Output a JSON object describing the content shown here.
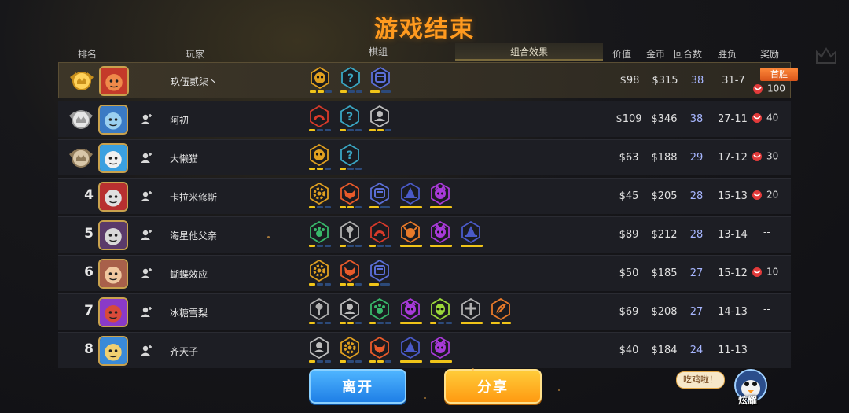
{
  "title": "游戏结束",
  "headers": {
    "rank": "排名",
    "player": "玩家",
    "tab_pieces": "棋组",
    "tab_synergy": "组合效果",
    "value": "价值",
    "gold": "金币",
    "rounds": "回合数",
    "wl": "胜负",
    "reward": "奖励"
  },
  "colors": {
    "accent": "#ff9a1f",
    "bar_on": "#f0c419",
    "bar_off": "#2c4a7a",
    "rounds": "#a7b6ff"
  },
  "players": [
    {
      "rank": "1",
      "medal": "gold-medal-icon",
      "name": "玖伍贰柒丶",
      "avatar": "red-ogre",
      "friend": false,
      "synergies": [
        {
          "icon": "head-icon",
          "ring": "#e0a020",
          "fill": "#e0a020",
          "bars": [
            1,
            1,
            0
          ]
        },
        {
          "icon": "question-icon",
          "ring": "#3aa7c4",
          "fill": "#3aa7c4",
          "bars": [
            1,
            0,
            0
          ]
        },
        {
          "icon": "mech-icon",
          "ring": "#5b6fd8",
          "fill": "#5b6fd8",
          "bars": [
            1,
            0
          ]
        }
      ],
      "value": "$98",
      "gold": "$315",
      "rounds": "38",
      "wl": "31-7",
      "badge": "首胜",
      "reward": "100"
    },
    {
      "rank": "2",
      "medal": "silver-medal-icon",
      "name": "阿初",
      "avatar": "blue-beast",
      "friend": true,
      "synergies": [
        {
          "icon": "arch-icon",
          "ring": "#d83a2a",
          "fill": "#d83a2a",
          "bars": [
            1,
            0,
            0
          ]
        },
        {
          "icon": "question-icon",
          "ring": "#3aa7c4",
          "fill": "#3aa7c4",
          "bars": [
            1,
            0,
            0
          ]
        },
        {
          "icon": "person-icon",
          "ring": "#bcbcbc",
          "fill": "#bcbcbc",
          "bars": [
            1,
            1,
            0
          ]
        }
      ],
      "value": "$109",
      "gold": "$346",
      "rounds": "38",
      "wl": "27-11",
      "badge": "",
      "reward": "40"
    },
    {
      "rank": "3",
      "medal": "bronze-medal-icon",
      "name": "大懒猫",
      "avatar": "penguin",
      "friend": true,
      "synergies": [
        {
          "icon": "head-icon",
          "ring": "#e0a020",
          "fill": "#e0a020",
          "bars": [
            1,
            1,
            0
          ]
        },
        {
          "icon": "question-icon",
          "ring": "#3aa7c4",
          "fill": "#3aa7c4",
          "bars": [
            1,
            0,
            0
          ]
        }
      ],
      "value": "$63",
      "gold": "$188",
      "rounds": "29",
      "wl": "17-12",
      "badge": "",
      "reward": "30"
    },
    {
      "rank": "4",
      "medal": "",
      "name": "卡拉米修斯",
      "avatar": "red-beast",
      "friend": true,
      "synergies": [
        {
          "icon": "gear-icon",
          "ring": "#e0a020",
          "fill": "#e0a020",
          "bars": [
            1,
            0,
            0
          ]
        },
        {
          "icon": "horned-icon",
          "ring": "#e85a2a",
          "fill": "#e85a2a",
          "bars": [
            1,
            1,
            0
          ]
        },
        {
          "icon": "mech-icon",
          "ring": "#5b6fd8",
          "fill": "#5b6fd8",
          "bars": [
            1,
            0
          ]
        },
        {
          "icon": "wizard-hat-icon",
          "ring": "#4a5ac8",
          "fill": "#4a5ac8",
          "bars": [
            1
          ]
        },
        {
          "icon": "demon-icon",
          "ring": "#a83ad8",
          "fill": "#a83ad8",
          "bars": [
            1
          ]
        }
      ],
      "value": "$45",
      "gold": "$205",
      "rounds": "28",
      "wl": "15-13",
      "badge": "",
      "reward": "20"
    },
    {
      "rank": "5",
      "medal": "",
      "name": "海星他父亲",
      "avatar": "dark-knight",
      "friend": true,
      "synergies": [
        {
          "icon": "paw-icon",
          "ring": "#38b86a",
          "fill": "#38b86a",
          "bars": [
            1,
            0,
            0
          ]
        },
        {
          "icon": "axe-icon",
          "ring": "#b0b0b0",
          "fill": "#b0b0b0",
          "bars": [
            1,
            0,
            0
          ]
        },
        {
          "icon": "arch-icon",
          "ring": "#d83a2a",
          "fill": "#d83a2a",
          "bars": [
            1,
            0,
            0
          ]
        },
        {
          "icon": "bull-icon",
          "ring": "#e87a2a",
          "fill": "#e87a2a",
          "bars": [
            1
          ]
        },
        {
          "icon": "demon-icon",
          "ring": "#a83ad8",
          "fill": "#a83ad8",
          "bars": [
            1
          ]
        },
        {
          "icon": "wizard-hat-icon",
          "ring": "#4a5ac8",
          "fill": "#4a5ac8",
          "bars": [
            1
          ]
        }
      ],
      "value": "$89",
      "gold": "$212",
      "rounds": "28",
      "wl": "13-14",
      "badge": "",
      "reward": "--"
    },
    {
      "rank": "6",
      "medal": "",
      "name": "蝴蝶效应",
      "avatar": "girl",
      "friend": true,
      "synergies": [
        {
          "icon": "gear-icon",
          "ring": "#e0a020",
          "fill": "#e0a020",
          "bars": [
            1,
            0,
            0
          ]
        },
        {
          "icon": "horned-icon",
          "ring": "#e85a2a",
          "fill": "#e85a2a",
          "bars": [
            1,
            1,
            0
          ]
        },
        {
          "icon": "mech-icon",
          "ring": "#5b6fd8",
          "fill": "#5b6fd8",
          "bars": [
            1,
            0
          ]
        }
      ],
      "value": "$50",
      "gold": "$185",
      "rounds": "27",
      "wl": "15-12",
      "badge": "",
      "reward": "10"
    },
    {
      "rank": "7",
      "medal": "",
      "name": "冰糖雪梨",
      "avatar": "red-hair",
      "friend": true,
      "synergies": [
        {
          "icon": "axe-icon",
          "ring": "#b0b0b0",
          "fill": "#b0b0b0",
          "bars": [
            1,
            0,
            0
          ]
        },
        {
          "icon": "person-icon",
          "ring": "#bcbcbc",
          "fill": "#bcbcbc",
          "bars": [
            1,
            1,
            0
          ]
        },
        {
          "icon": "paw-icon",
          "ring": "#38b86a",
          "fill": "#38b86a",
          "bars": [
            1,
            0,
            0
          ]
        },
        {
          "icon": "demon-icon",
          "ring": "#a83ad8",
          "fill": "#a83ad8",
          "bars": [
            1
          ]
        },
        {
          "icon": "alien-icon",
          "ring": "#9bd83a",
          "fill": "#9bd83a",
          "bars": [
            1,
            0,
            0
          ]
        },
        {
          "icon": "cross-icon",
          "ring": "#b0b0b0",
          "fill": "#b0b0b0",
          "bars": [
            1
          ]
        },
        {
          "icon": "feather-icon",
          "ring": "#e87a2a",
          "fill": "#e87a2a",
          "bars": [
            1,
            1
          ]
        }
      ],
      "value": "$69",
      "gold": "$208",
      "rounds": "27",
      "wl": "14-13",
      "badge": "",
      "reward": "--"
    },
    {
      "rank": "8",
      "medal": "",
      "name": "齐天子",
      "avatar": "blonde",
      "friend": true,
      "synergies": [
        {
          "icon": "person-icon",
          "ring": "#bcbcbc",
          "fill": "#bcbcbc",
          "bars": [
            1,
            0,
            0
          ]
        },
        {
          "icon": "gear-icon",
          "ring": "#e0a020",
          "fill": "#e0a020",
          "bars": [
            1,
            0,
            0
          ]
        },
        {
          "icon": "horned-icon",
          "ring": "#e85a2a",
          "fill": "#e85a2a",
          "bars": [
            1,
            1,
            0
          ]
        },
        {
          "icon": "wizard-hat-icon",
          "ring": "#4a5ac8",
          "fill": "#4a5ac8",
          "bars": [
            1
          ]
        },
        {
          "icon": "demon-icon",
          "ring": "#a83ad8",
          "fill": "#a83ad8",
          "bars": [
            1
          ]
        }
      ],
      "value": "$40",
      "gold": "$184",
      "rounds": "24",
      "wl": "11-13",
      "badge": "",
      "reward": "--"
    }
  ],
  "buttons": {
    "leave": "离开",
    "share": "分享"
  },
  "bubble": "吃鸡啦！",
  "mascot_label": "炫耀"
}
